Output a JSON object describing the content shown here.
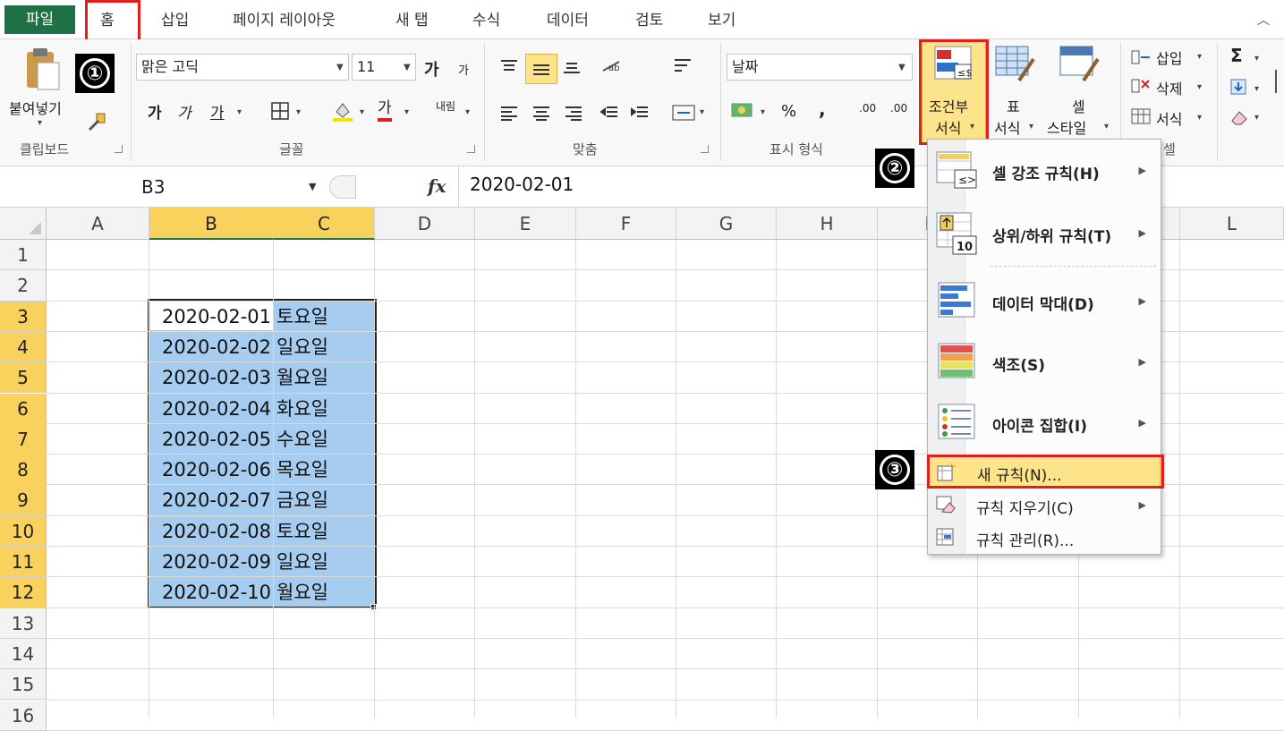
{
  "tabs": {
    "file": "파일",
    "home": "홈",
    "insert": "삽입",
    "page_layout": "페이지 레이아웃",
    "new_tab": "새 탭",
    "formulas": "수식",
    "data": "데이터",
    "review": "검토",
    "view": "보기"
  },
  "ribbon": {
    "clipboard": {
      "paste": "붙여넣기",
      "label": "클립보드"
    },
    "font": {
      "name": "맑은 고딕",
      "size": "11",
      "label": "글꼴",
      "bold": "가",
      "italic": "가",
      "underline": "가",
      "grow": "가",
      "shrink": "가",
      "font_color_glyph": "가",
      "wrap": "내림"
    },
    "alignment": {
      "label": "맞춤"
    },
    "number": {
      "format": "날짜",
      "percent": "%",
      "comma": ",",
      "label": "표시 형식",
      "inc_dec": ".00",
      "dec_dec": ".00"
    },
    "styles": {
      "conditional_formatting_line1": "조건부",
      "conditional_formatting_line2": "서식",
      "format_table_line1": "표",
      "format_table_line2": "서식",
      "cell_styles_line1": "셀",
      "cell_styles_line2": "스타일"
    },
    "cells": {
      "insert": "삽입",
      "delete": "삭제",
      "format": "서식",
      "label": "셀"
    },
    "editing": {
      "sum": "Σ"
    }
  },
  "formula_bar": {
    "name_box": "B3",
    "fx": "fx",
    "value": "2020-02-01"
  },
  "grid": {
    "columns": [
      "A",
      "B",
      "C",
      "D",
      "E",
      "F",
      "G",
      "H",
      "I",
      "J",
      "K",
      "L"
    ],
    "rows": [
      "1",
      "2",
      "3",
      "4",
      "5",
      "6",
      "7",
      "8",
      "9",
      "10",
      "11",
      "12",
      "13",
      "14",
      "15",
      "16"
    ],
    "data": [
      {
        "date": "2020-02-01",
        "day": "토요일"
      },
      {
        "date": "2020-02-02",
        "day": "일요일"
      },
      {
        "date": "2020-02-03",
        "day": "월요일"
      },
      {
        "date": "2020-02-04",
        "day": "화요일"
      },
      {
        "date": "2020-02-05",
        "day": "수요일"
      },
      {
        "date": "2020-02-06",
        "day": "목요일"
      },
      {
        "date": "2020-02-07",
        "day": "금요일"
      },
      {
        "date": "2020-02-08",
        "day": "토요일"
      },
      {
        "date": "2020-02-09",
        "day": "일요일"
      },
      {
        "date": "2020-02-10",
        "day": "월요일"
      }
    ]
  },
  "cf_menu": {
    "highlight": "셀 강조 규칙(H)",
    "top_bottom": "상위/하위 규칙(T)",
    "data_bars": "데이터 막대(D)",
    "color_scales": "색조(S)",
    "icon_sets": "아이콘 집합(I)",
    "new_rule": "새 규칙(N)...",
    "clear_rules": "규칙 지우기(C)",
    "manage_rules": "규칙 관리(R)..."
  },
  "callouts": [
    "①",
    "②",
    "③"
  ],
  "colors": {
    "excel_green": "#1e7145",
    "selection_blue": "#a6cdf0",
    "header_selected": "#f8d25c",
    "highlight_red": "#e02020",
    "menu_hover": "#fde38a"
  }
}
